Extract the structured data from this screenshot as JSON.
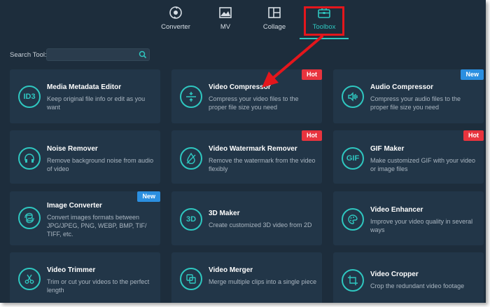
{
  "nav": [
    {
      "label": "Converter",
      "icon": "converter-icon",
      "active": false
    },
    {
      "label": "MV",
      "icon": "mv-icon",
      "active": false
    },
    {
      "label": "Collage",
      "icon": "collage-icon",
      "active": false
    },
    {
      "label": "Toolbox",
      "icon": "toolbox-icon",
      "active": true
    }
  ],
  "search": {
    "label": "Search Tool:",
    "value": "",
    "placeholder": ""
  },
  "accent_color": "#2fc7c0",
  "badge_colors": {
    "Hot": "#e8343e",
    "New": "#2b8fe0"
  },
  "tools": [
    {
      "title": "Media Metadata Editor",
      "desc": "Keep original file info or edit as you want",
      "icon": "id3-icon",
      "icon_text": "ID3",
      "badge": ""
    },
    {
      "title": "Video Compressor",
      "desc": "Compress your video files to the proper file size you need",
      "icon": "compress-icon",
      "icon_text": "",
      "badge": "Hot"
    },
    {
      "title": "Audio Compressor",
      "desc": "Compress your audio files to the proper file size you need",
      "icon": "audio-compress-icon",
      "icon_text": "",
      "badge": "New"
    },
    {
      "title": "Noise Remover",
      "desc": "Remove background noise from audio of video",
      "icon": "headphones-icon",
      "icon_text": "",
      "badge": ""
    },
    {
      "title": "Video Watermark Remover",
      "desc": "Remove the watermark from the video flexibly",
      "icon": "drop-icon",
      "icon_text": "",
      "badge": "Hot"
    },
    {
      "title": "GIF Maker",
      "desc": "Make customized GIF with your video or image files",
      "icon": "gif-icon",
      "icon_text": "GIF",
      "badge": "Hot"
    },
    {
      "title": "Image Converter",
      "desc": "Convert images formats between JPG/JPEG, PNG, WEBP, BMP, TIF/ TIFF, etc.",
      "icon": "image-convert-icon",
      "icon_text": "",
      "badge": "New"
    },
    {
      "title": "3D Maker",
      "desc": "Create customized 3D video from 2D",
      "icon": "3d-icon",
      "icon_text": "3D",
      "badge": ""
    },
    {
      "title": "Video Enhancer",
      "desc": "Improve your video quality in several ways",
      "icon": "palette-icon",
      "icon_text": "",
      "badge": ""
    },
    {
      "title": "Video Trimmer",
      "desc": "Trim or cut your videos to the perfect length",
      "icon": "scissors-icon",
      "icon_text": "",
      "badge": ""
    },
    {
      "title": "Video Merger",
      "desc": "Merge multiple clips into a single piece",
      "icon": "merge-icon",
      "icon_text": "",
      "badge": ""
    },
    {
      "title": "Video Cropper",
      "desc": "Crop the redundant video footage",
      "icon": "crop-icon",
      "icon_text": "",
      "badge": ""
    }
  ]
}
